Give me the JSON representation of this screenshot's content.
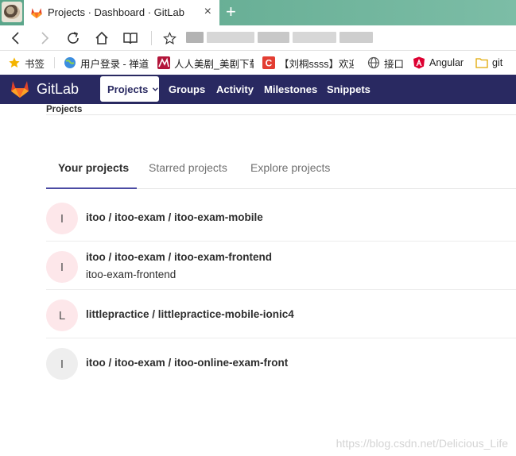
{
  "browser": {
    "tab_title": "Projects · Dashboard · GitLab",
    "tab_close": "×",
    "new_tab": "+",
    "bookmarks": [
      {
        "label": "书签",
        "icon": "star-icon"
      },
      {
        "label": "用户登录 - 禅道",
        "icon": "globe-icon"
      },
      {
        "label": "人人美剧_美剧下载",
        "icon": "rr-icon"
      },
      {
        "label": "【刘桐ssss】欢迎",
        "icon": "csdn-icon"
      },
      {
        "label": "接口",
        "icon": "globe-icon"
      },
      {
        "label": "Angular",
        "icon": "angular-icon"
      },
      {
        "label": "git",
        "icon": "folder-icon"
      }
    ]
  },
  "gitlab": {
    "brand": "GitLab",
    "nav": {
      "projects": "Projects",
      "groups": "Groups",
      "activity": "Activity",
      "milestones": "Milestones",
      "snippets": "Snippets"
    },
    "breadcrumb": "Projects",
    "tabs": [
      "Your projects",
      "Starred projects",
      "Explore projects"
    ],
    "projects": [
      {
        "avatar": "I",
        "name": "itoo / itoo-exam / itoo-exam-mobile",
        "description": ""
      },
      {
        "avatar": "I",
        "name": "itoo / itoo-exam / itoo-exam-frontend",
        "description": "itoo-exam-frontend"
      },
      {
        "avatar": "L",
        "name": "littlepractice / littlepractice-mobile-ionic4",
        "description": ""
      },
      {
        "avatar": "I",
        "name": "itoo / itoo-exam / itoo-online-exam-front",
        "description": ""
      }
    ]
  },
  "watermark": "https://blog.csdn.net/Delicious_Life",
  "colors": {
    "header_bg": "#292961",
    "tab_underline": "#4b4ba3",
    "avatar_pink": "#fde7ea",
    "avatar_grey": "#eeeeee"
  }
}
